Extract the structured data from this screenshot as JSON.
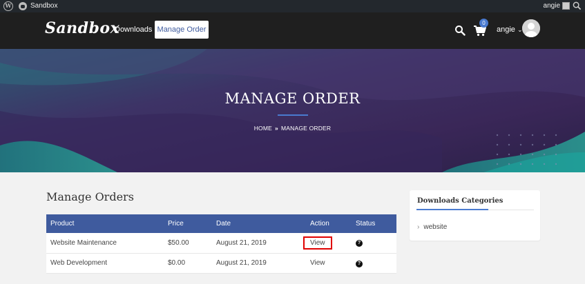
{
  "adminbar": {
    "site_name": "Sandbox",
    "user": "angie"
  },
  "header": {
    "logo": "Sandbox",
    "nav": {
      "downloads": "Downloads",
      "manage_order": "Manage Order"
    },
    "cart_count": "0",
    "user": "angie",
    "user_chevron": "⌄"
  },
  "hero": {
    "title": "MANAGE ORDER",
    "breadcrumb": {
      "home": "HOME",
      "sep": "»",
      "current": "MANAGE ORDER"
    }
  },
  "orders": {
    "title": "Manage Orders",
    "columns": [
      "Product",
      "Price",
      "Date",
      "Action",
      "Status"
    ],
    "rows": [
      {
        "product": "Website Maintenance",
        "price": "$50.00",
        "date": "August 21, 2019",
        "action": "View"
      },
      {
        "product": "Web Development",
        "price": "$0.00",
        "date": "August 21, 2019",
        "action": "View"
      }
    ],
    "status_icon": "question-circle-icon"
  },
  "sidebar": {
    "title": "Downloads Categories",
    "items": [
      {
        "label": "website"
      }
    ]
  },
  "colors": {
    "accent": "#3f5b9e",
    "badge": "#4a7bd0",
    "header_bg": "#1f1f1f",
    "highlight": "#e00000"
  }
}
